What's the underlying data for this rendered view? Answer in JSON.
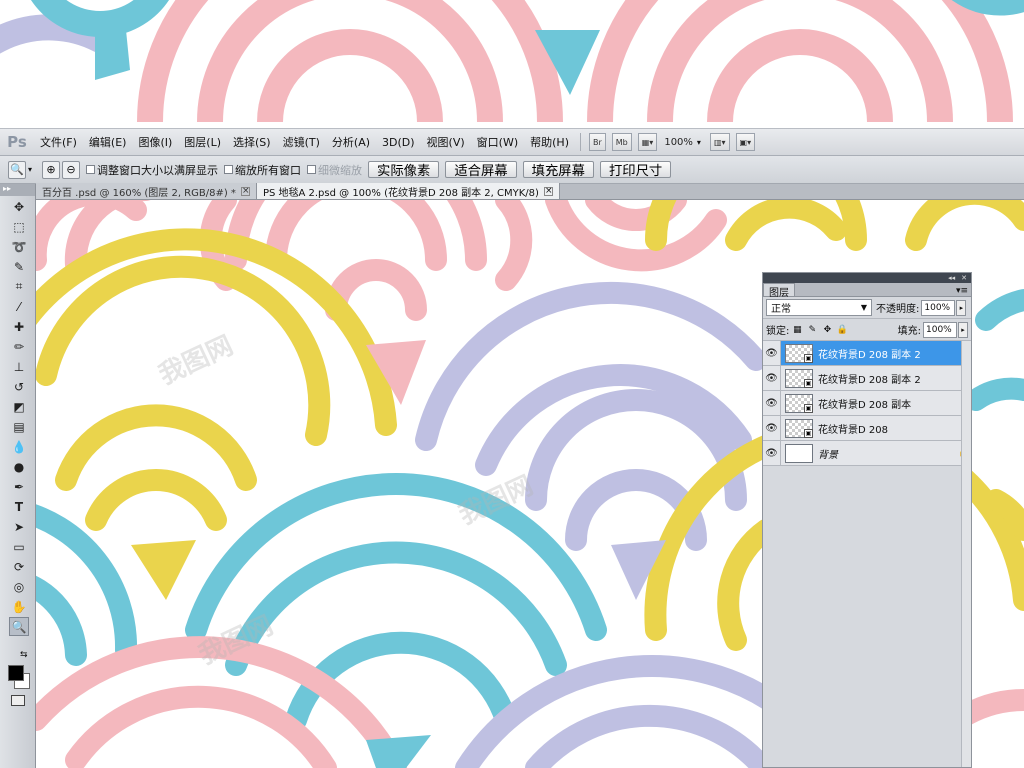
{
  "app": {
    "logo": "Ps"
  },
  "menubar": {
    "items": [
      "文件(F)",
      "编辑(E)",
      "图像(I)",
      "图层(L)",
      "选择(S)",
      "滤镜(T)",
      "分析(A)",
      "3D(D)",
      "视图(V)",
      "窗口(W)",
      "帮助(H)"
    ],
    "br_label": "Br",
    "mb_label": "Mb",
    "zoom_value": "100%"
  },
  "optionsbar": {
    "resize_windows_label": "调整窗口大小以满屏显示",
    "zoom_all_label": "缩放所有窗口",
    "scrubby_zoom_label": "细微缩放",
    "actual_pixels": "实际像素",
    "fit_screen": "适合屏幕",
    "fill_screen": "填充屏幕",
    "print_size": "打印尺寸"
  },
  "tabs": [
    {
      "label": "百分百 .psd @ 160% (图层 2, RGB/8#) *"
    },
    {
      "label": "PS 地毯A 2.psd @ 100% (花纹背景D 208 副本 2, CMYK/8)"
    }
  ],
  "layers_panel": {
    "title": "图层",
    "blend_mode": "正常",
    "opacity_label": "不透明度:",
    "opacity_value": "100%",
    "lock_label": "锁定:",
    "fill_label": "填充:",
    "fill_value": "100%",
    "layers": [
      {
        "name": "花纹背景D 208 副本 2",
        "selected": true
      },
      {
        "name": "花纹背景D 208 副本 2",
        "selected": false
      },
      {
        "name": "花纹背景D 208 副本",
        "selected": false
      },
      {
        "name": "花纹背景D 208",
        "selected": false
      },
      {
        "name": "背景",
        "selected": false,
        "locked": true
      }
    ]
  },
  "colors": {
    "pink": "#f4b8be",
    "yellow": "#ead44c",
    "lavender": "#bfc0e2",
    "blue": "#6ec6d8",
    "selection": "#3d96e8"
  },
  "watermark": "我图网"
}
